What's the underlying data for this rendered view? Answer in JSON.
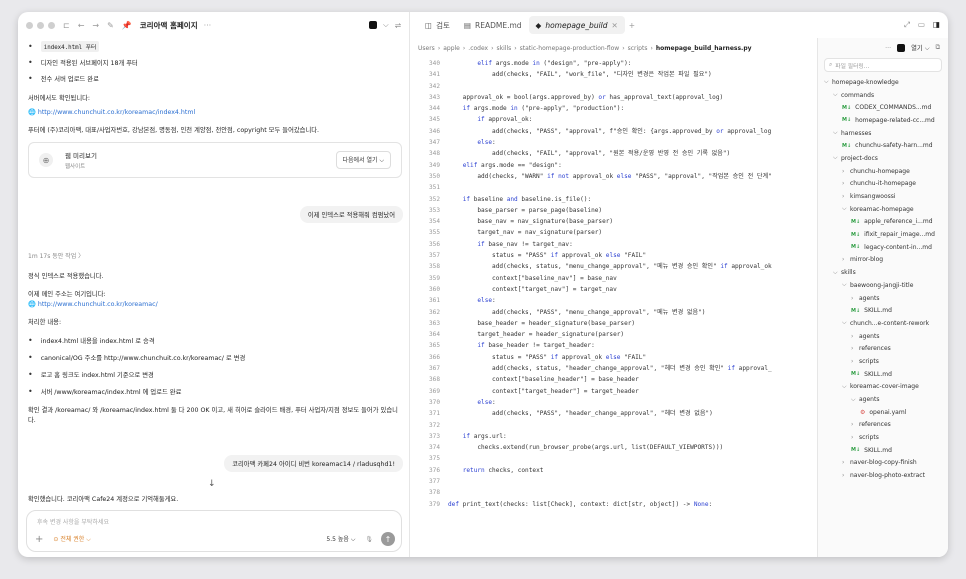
{
  "left_tab": {
    "title": "코리아맥 홈페이지",
    "more": "···"
  },
  "tabs": [
    {
      "label": "검토",
      "icon": "panel-icon",
      "active": false
    },
    {
      "label": "README.md",
      "icon": "file-icon",
      "active": false
    },
    {
      "label": "homepage_build",
      "icon": "python-icon",
      "active": true
    }
  ],
  "chat": {
    "top_bullets": [
      "index4.html 푸터",
      "디자인 적용된 서브페이지 18개 푸터",
      "전수 서버 업로드 완료"
    ],
    "server_check_label": "서버에서도 확인됩니다:",
    "link1": "http://www.chunchuit.co.kr/koreamac/index4.html",
    "footer_note": "푸터에 (주)코리아맥, 대표/사업자번호, 강남본점, 명동점, 인천 계양점, 천안점, copyright 모두 들어갔습니다.",
    "preview": {
      "title": "웹 미리보기",
      "subtitle": "웹사이트",
      "button": "다음에서 열기 ⌵"
    },
    "user_msg1": "이제 인덱스로 적용해줘 컴펌났어",
    "work_time": "1m 17s 동안 작업 〉",
    "applied": "정식 인덱스로 적용했습니다.",
    "main_addr_label": "이제 메인 주소는 여기입니다:",
    "link2": "http://www.chunchuit.co.kr/koreamac/",
    "process_label": "처리한 내용:",
    "process_items": [
      "index4.html 내용을 index.html 로 승격",
      "canonical/OG 주소를 http://www.chunchuit.co.kr/koreamac/ 로 변경",
      "로고 홈 링크도 index.html 기준으로 변경",
      "서버 /www/koreamac/index.html 에 업로드 완료"
    ],
    "result": "확인 결과 /koreamac/ 와 /koreamac/index.html 둘 다 200 OK 이고, 새 히어로 슬라이드 배경, 푸터 사업자/지점 정보도 들어가 있습니다.",
    "user_msg2": "코리아맥 카페24 아이디 비번  koreamac14 / rladusqhd1!",
    "scroll_down": "↓",
    "reply": "확인했습니다. 코리아맥 Cafe24 계정으로 기억해둘게요.",
    "composer": {
      "placeholder": "후속 변경 사항을 부탁하세요",
      "permission": "⊙ 전체 권한 ⌵",
      "model": "5.5 높음 ⌵"
    }
  },
  "breadcrumb": [
    "Users",
    "apple",
    ".codex",
    "skills",
    "static-homepage-production-flow",
    "scripts",
    "homepage_build_harness.py"
  ],
  "code_lines": [
    {
      "n": "340",
      "t": "        elif args.mode in (\"design\", \"pre-apply\"):"
    },
    {
      "n": "341",
      "t": "            add(checks, \"FAIL\", \"work_file\", \"디자인 변경은 작업본 파일 필요\")"
    },
    {
      "n": "342",
      "t": ""
    },
    {
      "n": "343",
      "t": "    approval_ok = bool(args.approved_by) or has_approval_text(approval_log)"
    },
    {
      "n": "344",
      "t": "    if args.mode in (\"pre-apply\", \"production\"):"
    },
    {
      "n": "345",
      "t": "        if approval_ok:"
    },
    {
      "n": "346",
      "t": "            add(checks, \"PASS\", \"approval\", f\"승인 확인: {args.approved_by or approval_log"
    },
    {
      "n": "347",
      "t": "        else:"
    },
    {
      "n": "348",
      "t": "            add(checks, \"FAIL\", \"approval\", \"원본 적용/운영 반영 전 승인 기록 없음\")"
    },
    {
      "n": "349",
      "t": "    elif args.mode == \"design\":"
    },
    {
      "n": "350",
      "t": "        add(checks, \"WARN\" if not approval_ok else \"PASS\", \"approval\", \"작업본 승인 전 단계\""
    },
    {
      "n": "351",
      "t": ""
    },
    {
      "n": "352",
      "t": "    if baseline and baseline.is_file():"
    },
    {
      "n": "353",
      "t": "        base_parser = parse_page(baseline)"
    },
    {
      "n": "354",
      "t": "        base_nav = nav_signature(base_parser)"
    },
    {
      "n": "355",
      "t": "        target_nav = nav_signature(parser)"
    },
    {
      "n": "356",
      "t": "        if base_nav != target_nav:"
    },
    {
      "n": "357",
      "t": "            status = \"PASS\" if approval_ok else \"FAIL\""
    },
    {
      "n": "358",
      "t": "            add(checks, status, \"menu_change_approval\", \"메뉴 변경 승인 확인\" if approval_ok"
    },
    {
      "n": "359",
      "t": "            context[\"baseline_nav\"] = base_nav"
    },
    {
      "n": "360",
      "t": "            context[\"target_nav\"] = target_nav"
    },
    {
      "n": "361",
      "t": "        else:"
    },
    {
      "n": "362",
      "t": "            add(checks, \"PASS\", \"menu_change_approval\", \"메뉴 변경 없음\")"
    },
    {
      "n": "363",
      "t": "        base_header = header_signature(base_parser)"
    },
    {
      "n": "364",
      "t": "        target_header = header_signature(parser)"
    },
    {
      "n": "365",
      "t": "        if base_header != target_header:"
    },
    {
      "n": "366",
      "t": "            status = \"PASS\" if approval_ok else \"FAIL\""
    },
    {
      "n": "367",
      "t": "            add(checks, status, \"header_change_approval\", \"헤더 변경 승인 확인\" if approval_"
    },
    {
      "n": "368",
      "t": "            context[\"baseline_header\"] = base_header"
    },
    {
      "n": "369",
      "t": "            context[\"target_header\"] = target_header"
    },
    {
      "n": "370",
      "t": "        else:"
    },
    {
      "n": "371",
      "t": "            add(checks, \"PASS\", \"header_change_approval\", \"헤더 변경 없음\")"
    },
    {
      "n": "372",
      "t": ""
    },
    {
      "n": "373",
      "t": "    if args.url:"
    },
    {
      "n": "374",
      "t": "        checks.extend(run_browser_probe(args.url, list(DEFAULT_VIEWPORTS)))"
    },
    {
      "n": "375",
      "t": ""
    },
    {
      "n": "376",
      "t": "    return checks, context"
    },
    {
      "n": "377",
      "t": ""
    },
    {
      "n": "378",
      "t": ""
    },
    {
      "n": "379",
      "t": "def print_text(checks: list[Check], context: dict[str, object]) -> None:"
    }
  ],
  "explorer": {
    "open_label": "열기 ⌵",
    "search_placeholder": "파일 필터링...",
    "items": [
      {
        "label": "homepage-knowledge",
        "indent": 0,
        "kind": "open"
      },
      {
        "label": "commands",
        "indent": 1,
        "kind": "open"
      },
      {
        "label": "CODEX_COMMANDS...md",
        "indent": 2,
        "kind": "md"
      },
      {
        "label": "homepage-related-cc...md",
        "indent": 2,
        "kind": "md"
      },
      {
        "label": "harnesses",
        "indent": 1,
        "kind": "open"
      },
      {
        "label": "chunchu-safety-harn...md",
        "indent": 2,
        "kind": "md"
      },
      {
        "label": "project-docs",
        "indent": 1,
        "kind": "open"
      },
      {
        "label": "chunchu-homepage",
        "indent": 2,
        "kind": "closed"
      },
      {
        "label": "chunchu-it-homepage",
        "indent": 2,
        "kind": "closed"
      },
      {
        "label": "kimsangwoossi",
        "indent": 2,
        "kind": "closed"
      },
      {
        "label": "koreamac-homepage",
        "indent": 2,
        "kind": "open"
      },
      {
        "label": "apple_reference_i...md",
        "indent": 3,
        "kind": "md"
      },
      {
        "label": "ifixit_repair_image...md",
        "indent": 3,
        "kind": "md"
      },
      {
        "label": "legacy-content-in...md",
        "indent": 3,
        "kind": "md"
      },
      {
        "label": "mirror-blog",
        "indent": 2,
        "kind": "closed"
      },
      {
        "label": "skills",
        "indent": 1,
        "kind": "open"
      },
      {
        "label": "baewoong-jangji-title",
        "indent": 2,
        "kind": "open"
      },
      {
        "label": "agents",
        "indent": 3,
        "kind": "closed"
      },
      {
        "label": "SKILL.md",
        "indent": 3,
        "kind": "md"
      },
      {
        "label": "chunch...e-content-rework",
        "indent": 2,
        "kind": "open"
      },
      {
        "label": "agents",
        "indent": 3,
        "kind": "closed"
      },
      {
        "label": "references",
        "indent": 3,
        "kind": "closed"
      },
      {
        "label": "scripts",
        "indent": 3,
        "kind": "closed"
      },
      {
        "label": "SKILL.md",
        "indent": 3,
        "kind": "md"
      },
      {
        "label": "koreamac-cover-image",
        "indent": 2,
        "kind": "open"
      },
      {
        "label": "agents",
        "indent": 3,
        "kind": "open"
      },
      {
        "label": "openai.yaml",
        "indent": 4,
        "kind": "yaml"
      },
      {
        "label": "references",
        "indent": 3,
        "kind": "closed"
      },
      {
        "label": "scripts",
        "indent": 3,
        "kind": "closed"
      },
      {
        "label": "SKILL.md",
        "indent": 3,
        "kind": "md"
      },
      {
        "label": "naver-blog-copy-finish",
        "indent": 2,
        "kind": "closed"
      },
      {
        "label": "naver-blog-photo-extract",
        "indent": 2,
        "kind": "closed"
      }
    ]
  }
}
